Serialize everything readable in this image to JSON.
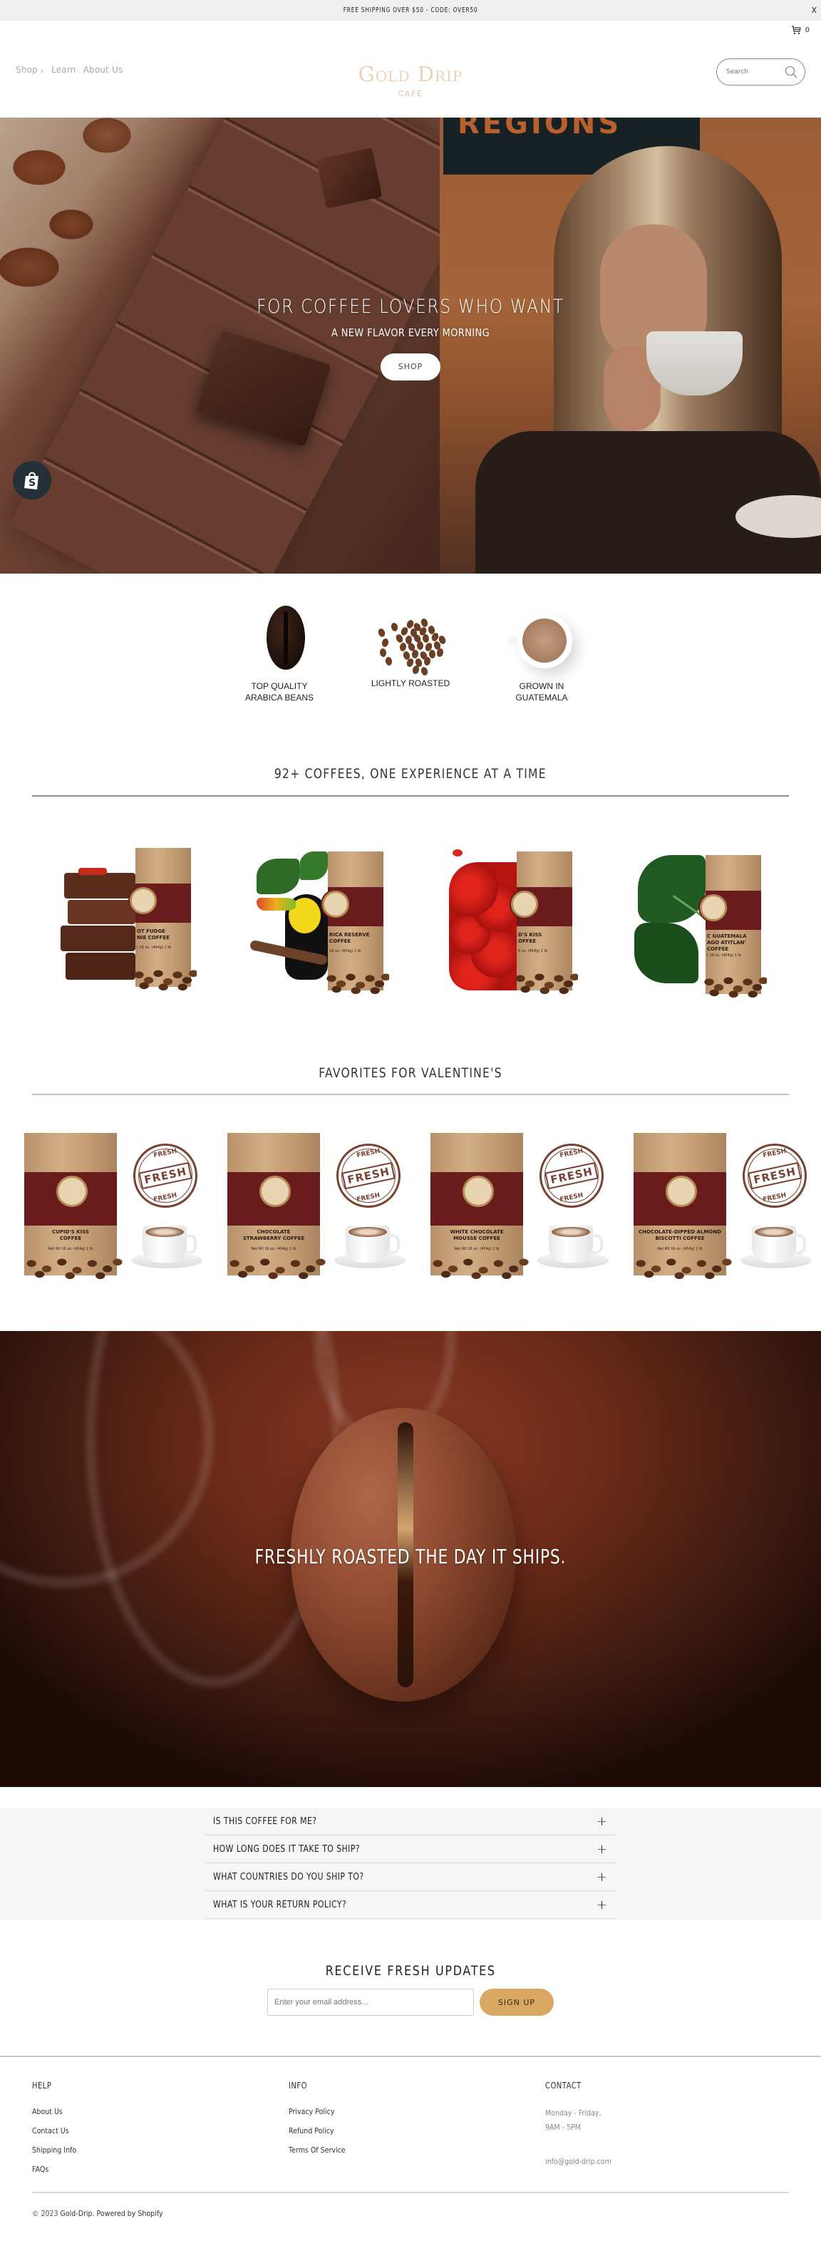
{
  "announcement": {
    "text": "FREE SHIPPING OVER $50 - CODE: OVER50",
    "close_label": "X"
  },
  "header": {
    "cart_count": "0",
    "nav": [
      {
        "label": "Shop",
        "has_dropdown": true
      },
      {
        "label": "Learn",
        "has_dropdown": false
      },
      {
        "label": "About Us",
        "has_dropdown": false
      }
    ],
    "logo": {
      "main": "Gold Drip",
      "sub": "CAFÉ"
    },
    "search_placeholder": "Search",
    "logo_color": "#ecd1b4"
  },
  "hero": {
    "title": "FOR COFFEE LOVERS WHO WANT",
    "subtitle": "A NEW FLAVOR EVERY MORNING",
    "button_label": "SHOP",
    "background_sign_text": "REGIONS"
  },
  "features": [
    {
      "icon": "coffee-bean-icon",
      "label_line1": "TOP QUALITY",
      "label_line2": "ARABICA BEANS"
    },
    {
      "icon": "bean-pile-icon",
      "label_line1": "LIGHTLY ROASTED",
      "label_line2": ""
    },
    {
      "icon": "coffee-cup-icon",
      "label_line1": "GROWN IN",
      "label_line2": "GUATEMALA"
    }
  ],
  "collection1": {
    "heading": "92+ COFFEES, ONE EXPERIENCE AT A TIME",
    "products": [
      {
        "label_line1": "OT FUDGE",
        "label_line2": "NIE COFFEE",
        "weight": "t 16 oz. (454g)   1 lb",
        "visual": "brownies"
      },
      {
        "label_line1": "RICA RESERVE",
        "label_line2": "COFFEE",
        "weight": "16 oz. (454g)   1 lb",
        "visual": "toucan"
      },
      {
        "label_line1": "D'S KISS",
        "label_line2": "OFFEE",
        "weight": "6 oz. (454g)   1 lb",
        "visual": "roses"
      },
      {
        "label_line1": "C GUATEMALA",
        "label_line2": "AGO ATITLAN'",
        "label_line3": "COFFEE",
        "weight": "t 16 oz. (454g)   1 lb",
        "visual": "monstera-leaves"
      }
    ]
  },
  "collection2": {
    "heading": "FAVORITES FOR VALENTINE'S",
    "stamp_text": "FRESH",
    "products": [
      {
        "label_line1": "CUPID'S KISS",
        "label_line2": "COFFEE",
        "weight": "Net Wt 16 oz. (454g)   1 lb"
      },
      {
        "label_line1": "CHOCOLATE",
        "label_line2": "STRAWBERRY COFFEE",
        "weight": "Net Wt 16 oz. (454g)   1 lb"
      },
      {
        "label_line1": "WHITE CHOCOLATE",
        "label_line2": "MOUSSE COFFEE",
        "weight": "Net Wt 16 oz. (454g)   1 lb"
      },
      {
        "label_line1": "CHOCOLATE-DIPPED ALMOND",
        "label_line2": "BISCOTTI COFFEE",
        "weight": "Net Wt 16 oz. (454g)   1 lb"
      }
    ]
  },
  "banner": {
    "text": "FRESHLY ROASTED THE DAY IT SHIPS."
  },
  "faq": [
    {
      "question": "IS THIS COFFEE FOR ME?"
    },
    {
      "question": "HOW LONG DOES IT TAKE TO SHIP?"
    },
    {
      "question": "WHAT COUNTRIES DO YOU SHIP TO?"
    },
    {
      "question": "WHAT IS YOUR RETURN POLICY?"
    }
  ],
  "newsletter": {
    "title": "RECEIVE FRESH UPDATES",
    "placeholder": "Enter your email address...",
    "button_label": "SIGN UP",
    "button_color": "#d9a963"
  },
  "footer": {
    "help": {
      "heading": "HELP",
      "links": [
        "About Us",
        "Contact Us",
        "Shipping Info",
        "FAQs"
      ]
    },
    "info": {
      "heading": "INFO",
      "links": [
        "Privacy Policy",
        "Refund Policy",
        "Terms Of Service"
      ]
    },
    "contact": {
      "heading": "CONTACT",
      "hours_line1": "Monday - Friday,",
      "hours_line2": "9AM - 5PM",
      "email": "info@gold-drip.com"
    },
    "copyright_prefix": "© 2023",
    "copyright_brand": "Gold-Drip.",
    "powered_by": "Powered by Shopify"
  }
}
